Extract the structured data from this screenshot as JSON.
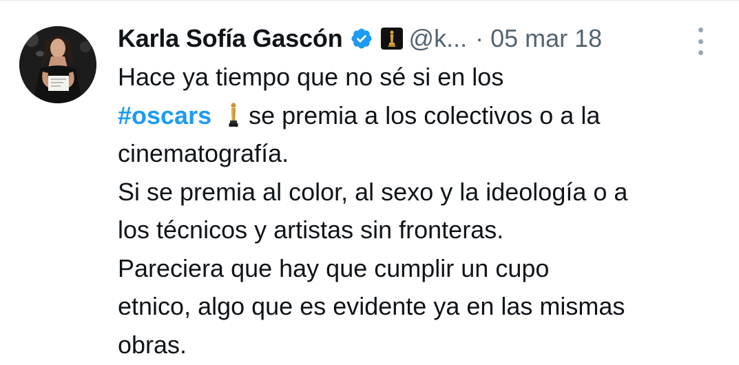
{
  "tweet": {
    "author": {
      "display_name": "Karla Sofía Gascón",
      "handle": "@k...",
      "verified_icon": "verified-badge-icon",
      "affiliate_icon": "oscar-statuette-badge-icon"
    },
    "separator": "·",
    "timestamp": "05 mar 18",
    "more_icon": "more-vertical-icon",
    "text": {
      "line1": "Hace ya tiempo que no sé si en los",
      "hashtag": "#oscars",
      "line2_rest": "se premia a los colectivos o a la",
      "line3": "cinematografía.",
      "line4": "Si se premia al color, al sexo y la ideología o a",
      "line5": "los técnicos y artistas sin fronteras.",
      "line6": "Pareciera que hay que cumplir un cupo",
      "line7": "etnico, algo que es evidente ya en las mismas",
      "line8": "obras."
    }
  },
  "colors": {
    "text_primary": "#0f1419",
    "text_secondary": "#536471",
    "accent": "#1d9bf0",
    "oscar_gold": "#c9962e"
  }
}
